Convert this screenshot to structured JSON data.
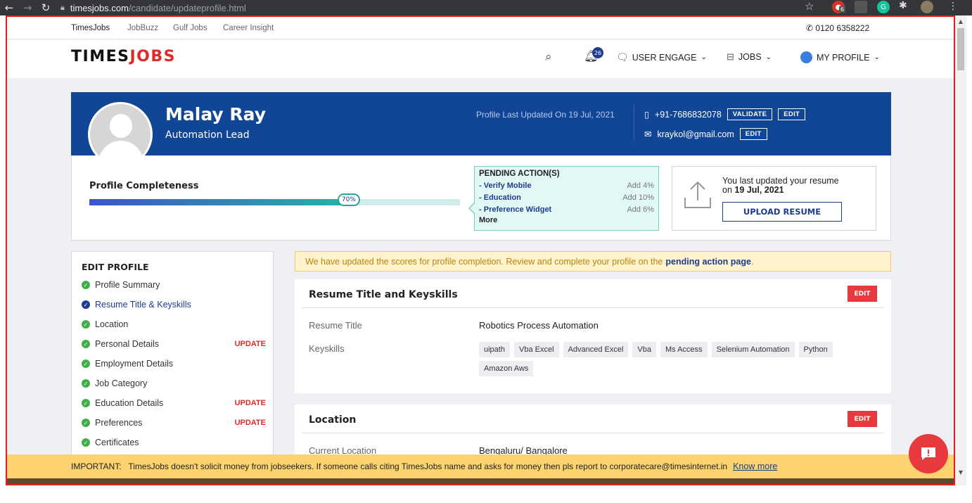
{
  "browser": {
    "url_host": "timesjobs.com",
    "url_path": "/candidate/updateprofile.html",
    "ext_badge": "6"
  },
  "toplinks": [
    "TimesJobs",
    "JobBuzz",
    "Gulf Jobs",
    "Career Insight"
  ],
  "phone": "0120 6358222",
  "logo": {
    "part1": "TIMES",
    "part2": "JOBS"
  },
  "nav": {
    "notif_count": "26",
    "user_engage": "USER ENGAGE",
    "jobs": "JOBS",
    "my_profile": "MY PROFILE"
  },
  "profile": {
    "name": "Malay Ray",
    "role": "Automation Lead",
    "last_updated": "Profile Last Updated On 19 Jul, 2021",
    "mobile": "+91-7686832078",
    "email": "kraykol@gmail.com",
    "validate_label": "VALIDATE",
    "edit_label": "EDIT"
  },
  "completeness": {
    "title": "Profile Completeness",
    "percent": 70,
    "percent_label": "70%"
  },
  "pending": {
    "heading": "PENDING ACTION(S)",
    "items": [
      {
        "label": "Verify Mobile",
        "add": "Add 4%"
      },
      {
        "label": "Education",
        "add": "Add 10%"
      },
      {
        "label": "Preference Widget",
        "add": "Add 6%"
      }
    ],
    "more": "More"
  },
  "resume_upload": {
    "line1": "You last updated your resume",
    "line2_prefix": "on",
    "line2_date": "19 Jul, 2021",
    "button": "UPLOAD RESUME"
  },
  "sidebar": {
    "heading": "EDIT PROFILE",
    "update_label": "UPDATE",
    "items": [
      {
        "label": "Profile Summary",
        "update": false
      },
      {
        "label": "Resume Title & Keyskills",
        "update": false,
        "active": true
      },
      {
        "label": "Location",
        "update": false
      },
      {
        "label": "Personal Details",
        "update": true
      },
      {
        "label": "Employment Details",
        "update": false
      },
      {
        "label": "Job Category",
        "update": false
      },
      {
        "label": "Education Details",
        "update": true
      },
      {
        "label": "Preferences",
        "update": true
      },
      {
        "label": "Certificates",
        "update": false
      }
    ]
  },
  "notice": {
    "text": "We have updated the scores for profile completion. Review and complete your profile on the",
    "link": "pending action page",
    "end": "."
  },
  "resume_card": {
    "title": "Resume Title and Keyskills",
    "edit": "EDIT",
    "resume_title_label": "Resume Title",
    "resume_title_value": "Robotics Process Automation",
    "keyskills_label": "Keyskills",
    "keyskills": [
      "uipath",
      "Vba Excel",
      "Advanced Excel",
      "Vba",
      "Ms Access",
      "Selenium Automation",
      "Python",
      "Amazon Aws"
    ]
  },
  "location_card": {
    "title": "Location",
    "edit": "EDIT",
    "current_label": "Current Location",
    "current_value": "Bengaluru/ Bangalore"
  },
  "important": {
    "text": "IMPORTANT:   TimesJobs doesn't solicit money from jobseekers. If someone calls citing TimesJobs name and asks for money then pls report to corporatecare@timesinternet.in",
    "link": "Know more"
  },
  "colors": {
    "brand_blue": "#114596",
    "accent_red": "#e8393e",
    "notice_bg": "#fef3cd",
    "important_bg": "#fdd36f"
  }
}
